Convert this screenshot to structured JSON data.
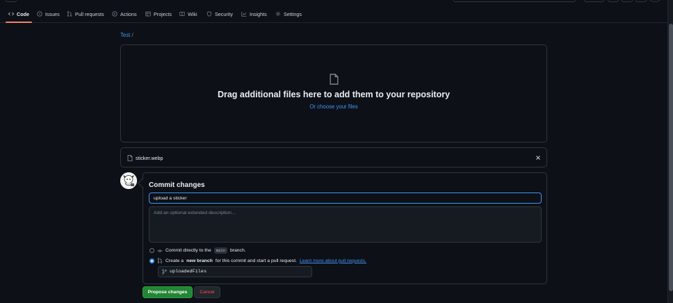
{
  "nav": {
    "tabs": [
      {
        "label": "Code",
        "icon": "code-icon",
        "active": true
      },
      {
        "label": "Issues",
        "icon": "issue-icon"
      },
      {
        "label": "Pull requests",
        "icon": "pull-request-icon"
      },
      {
        "label": "Actions",
        "icon": "play-icon"
      },
      {
        "label": "Projects",
        "icon": "table-icon"
      },
      {
        "label": "Wiki",
        "icon": "book-icon"
      },
      {
        "label": "Security",
        "icon": "shield-icon"
      },
      {
        "label": "Insights",
        "icon": "graph-icon"
      },
      {
        "label": "Settings",
        "icon": "gear-icon"
      }
    ]
  },
  "breadcrumb": {
    "repo": "Test",
    "separator": "/"
  },
  "dropzone": {
    "title": "Drag additional files here to add them to your repository",
    "prefix": "Or",
    "link": "choose your files"
  },
  "file": {
    "name": "sticker.webp"
  },
  "commit": {
    "title": "Commit changes",
    "message": "upload a sticker",
    "description_placeholder": "Add an optional extended description…",
    "option_direct": {
      "before": "Commit directly to the",
      "branch": "main",
      "after": "branch.",
      "selected": false
    },
    "option_new": {
      "before": "Create a",
      "bold": "new branch",
      "after": "for this commit and start a pull request.",
      "link": "Learn more about pull requests.",
      "selected": true
    },
    "branch_name": "uploadedFiles"
  },
  "buttons": {
    "propose": "Propose changes",
    "cancel": "Cancel"
  },
  "colors": {
    "accent": "#4493f8",
    "primary": "#238636",
    "danger": "#f85149",
    "tab_underline": "#f78166"
  }
}
